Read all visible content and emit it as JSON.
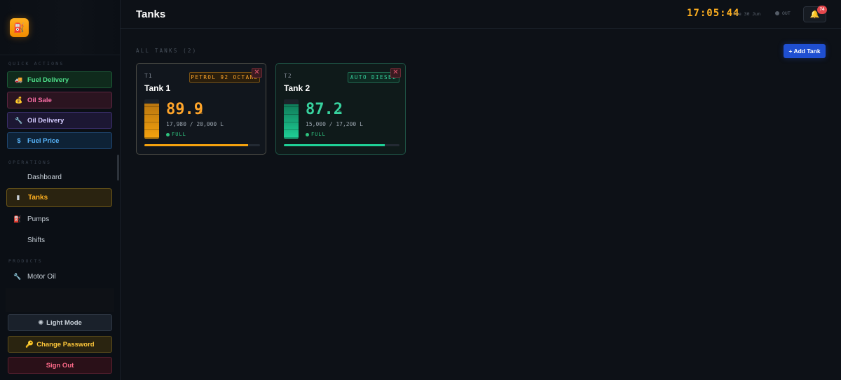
{
  "sidebar": {
    "logo_icon": "fuel-pump-icon",
    "quick_actions_label": "QUICK ACTIONS",
    "quick_actions": [
      {
        "label": "Fuel Delivery",
        "icon": "truck-icon",
        "glyph": "🚚"
      },
      {
        "label": "Oil Sale",
        "icon": "money-bag-icon",
        "glyph": "💰"
      },
      {
        "label": "Oil Delivery",
        "icon": "wrench-icon",
        "glyph": "🔧"
      },
      {
        "label": "Fuel Price",
        "icon": "dollar-icon",
        "glyph": "$"
      }
    ],
    "operations_label": "OPERATIONS",
    "operations": [
      {
        "label": "Dashboard",
        "icon": "dashboard-icon",
        "glyph": ""
      },
      {
        "label": "Tanks",
        "icon": "tank-icon",
        "glyph": "▮"
      },
      {
        "label": "Pumps",
        "icon": "pump-icon",
        "glyph": "⛽"
      },
      {
        "label": "Shifts",
        "icon": "clock-icon",
        "glyph": ""
      }
    ],
    "products_label": "PRODUCTS",
    "products": [
      {
        "label": "Motor Oil",
        "icon": "wrench-icon",
        "glyph": "🔧"
      }
    ],
    "footer": {
      "light_mode": "Light Mode",
      "light_glyph": "✺",
      "change_password": "Change Password",
      "password_glyph": "🔑",
      "sign_out": "Sign Out"
    }
  },
  "header": {
    "title": "Tanks",
    "clock": "17:05:44",
    "date": "Tue 30 Jun",
    "shift_status": "OUT",
    "bell_glyph": "🔔",
    "notification_count": "74"
  },
  "main": {
    "list_label": "ALL TANKS (2)",
    "add_button": "+ Add Tank",
    "tanks": [
      {
        "code": "T1",
        "name": "Tank 1",
        "fuel": "PETROL 92 OCTANE",
        "percent": "89.9",
        "percent_sign": "%",
        "volume": "17,980 / 20,000 L",
        "status": "FULL",
        "fill_fraction": 0.899,
        "color": "#f5a20e",
        "close": "✕"
      },
      {
        "code": "T2",
        "name": "Tank 2",
        "fuel": "AUTO DIESEL",
        "percent": "87.2",
        "percent_sign": "%",
        "volume": "15,000 / 17,200 L",
        "status": "FULL",
        "fill_fraction": 0.872,
        "color": "#1fd197",
        "close": "✕"
      }
    ]
  }
}
